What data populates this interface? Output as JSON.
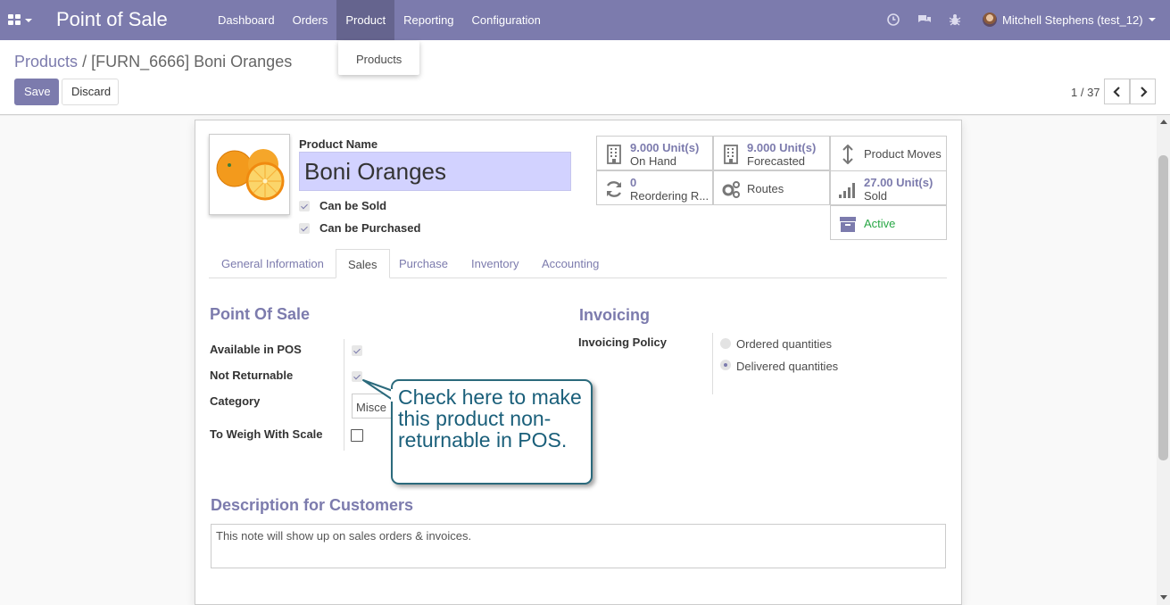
{
  "navbar": {
    "app_name": "Point of Sale",
    "menu": [
      {
        "label": "Dashboard"
      },
      {
        "label": "Orders"
      },
      {
        "label": "Product"
      },
      {
        "label": "Reporting"
      },
      {
        "label": "Configuration"
      }
    ],
    "user": "Mitchell Stephens (test_12)"
  },
  "dropdown": {
    "item": "Products"
  },
  "breadcrumb": {
    "parent": "Products",
    "separator": "/",
    "current": "[FURN_6666] Boni Oranges"
  },
  "buttons": {
    "save": "Save",
    "discard": "Discard"
  },
  "pager": {
    "value": "1 / 37"
  },
  "product": {
    "name_label": "Product Name",
    "name": "Boni Oranges",
    "can_be_sold": "Can be Sold",
    "can_be_purchased": "Can be Purchased"
  },
  "stats": {
    "on_hand": {
      "value": "9.000 Unit(s)",
      "label": "On Hand"
    },
    "forecasted": {
      "value": "9.000 Unit(s)",
      "label": "Forecasted"
    },
    "product_moves": "Product Moves",
    "reordering": {
      "value": "0",
      "label": "Reordering R..."
    },
    "routes": "Routes",
    "sold": {
      "value": "27.00 Unit(s)",
      "label": "Sold"
    },
    "active": "Active"
  },
  "tabs": [
    "General Information",
    "Sales",
    "Purchase",
    "Inventory",
    "Accounting"
  ],
  "sales": {
    "pos_title": "Point Of Sale",
    "available_in_pos": "Available in POS",
    "not_returnable": "Not Returnable",
    "category": "Category",
    "category_value": "Misce",
    "to_weigh": "To Weigh With Scale",
    "invoicing_title": "Invoicing",
    "invoicing_policy": "Invoicing Policy",
    "ordered": "Ordered quantities",
    "delivered": "Delivered quantities",
    "description_title": "Description for Customers",
    "description_placeholder": "This note will show up on sales orders & invoices."
  },
  "callout": {
    "text": "Check here to make this product non-returnable in POS."
  },
  "colors": {
    "brand": "#7c7bad",
    "active_green": "#28a745",
    "callout_border": "#2b6a7c"
  }
}
